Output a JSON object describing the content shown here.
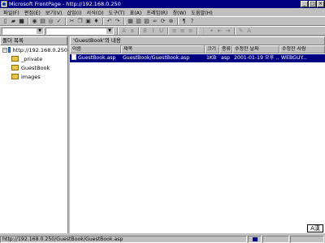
{
  "window": {
    "title": "Microsoft FrontPage - http://192.168.0.250"
  },
  "menubar": {
    "items": [
      "파일(F)",
      "편집(E)",
      "보기(V)",
      "삽입(I)",
      "서식(O)",
      "도구(T)",
      "표(A)",
      "프레임(R)",
      "창(W)",
      "도움말(H)"
    ]
  },
  "toolbar2": {
    "style_value": "",
    "font_value": ""
  },
  "folder_list": {
    "title": "폴더 목록",
    "root": "http://192.168.0.250",
    "children": [
      "_private",
      "GuestBook",
      "images"
    ]
  },
  "contents": {
    "title": "'GuestBook'의 내용",
    "columns": [
      "이름",
      "제목",
      "크기",
      "종류",
      "수정한 날짜",
      "수정한 사람"
    ],
    "rows": [
      [
        "GuestBook.asp",
        "GuestBook/GuestBook.asp",
        "1KB",
        "asp",
        "2001-01-19 오후 ...",
        "WEBGUY..."
      ]
    ]
  },
  "ime": {
    "label": "A漢"
  },
  "statusbar": {
    "text": "http://192.168.0.250/GuestBook/GuestBook.asp"
  },
  "colors": {
    "title_bar": "#000080",
    "selection": "#000080",
    "face": "#c0c0c0"
  }
}
